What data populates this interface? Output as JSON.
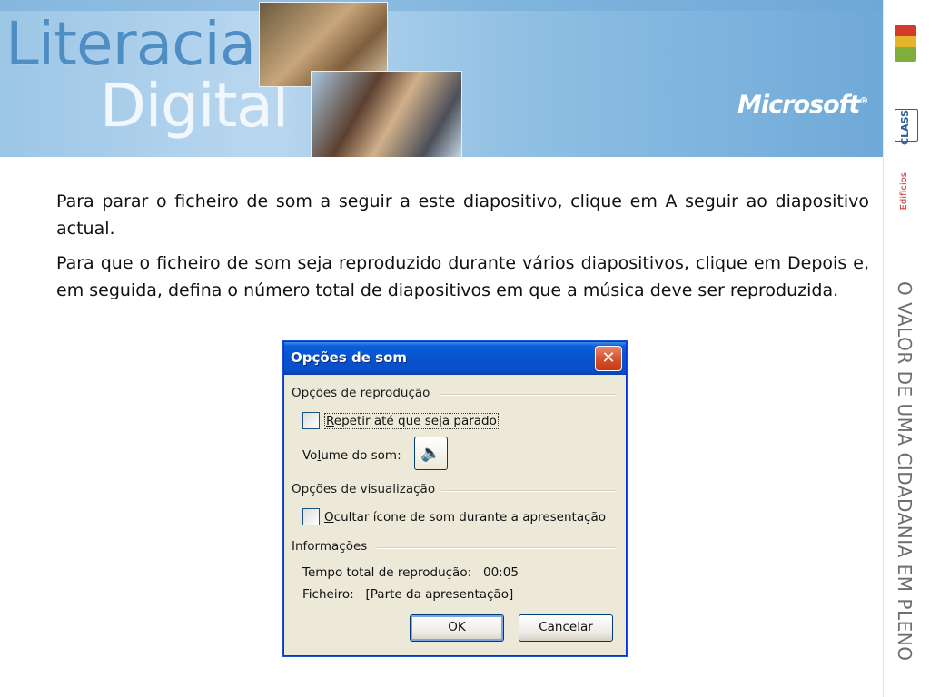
{
  "banner": {
    "title_line1": "Literacia",
    "title_line2": "Digital",
    "brand": "Microsoft",
    "brand_mark": "®"
  },
  "sidebar": {
    "logo2_text": "CLASS",
    "logo3_text": "Edifícios",
    "vertical_text": "O VALOR DE UMA CIDADANIA EM PLENO"
  },
  "content": {
    "paragraph1": "Para parar o ficheiro de som a seguir a este diapositivo, clique em A seguir ao diapositivo actual.",
    "paragraph2": "Para que o ficheiro de som seja reproduzido durante vários diapositivos, clique em Depois e, em seguida, defina o número total de diapositivos em que a música deve ser reproduzida."
  },
  "dialog": {
    "title": "Opções de som",
    "close_glyph": "✕",
    "group_playback": "Opções de reprodução",
    "checkbox_loop_first": "R",
    "checkbox_loop_rest": "epetir até que seja parado",
    "volume_label_a": "Vo",
    "volume_label_b": "l",
    "volume_label_c": "ume do som:",
    "speaker_glyph": "🔈",
    "group_display": "Opções de visualização",
    "checkbox_hide_first": "O",
    "checkbox_hide_rest": "cultar ícone de som durante a apresentação",
    "group_info": "Informações",
    "total_time_label": "Tempo total de reprodução:   00:05",
    "file_label": "Ficheiro:   [Parte da apresentação]",
    "ok_label": "OK",
    "cancel_label": "Cancelar"
  },
  "colors": {
    "titlebar_blue": "#0854d0",
    "dialog_face": "#ece9d8",
    "close_red": "#d6532e"
  }
}
